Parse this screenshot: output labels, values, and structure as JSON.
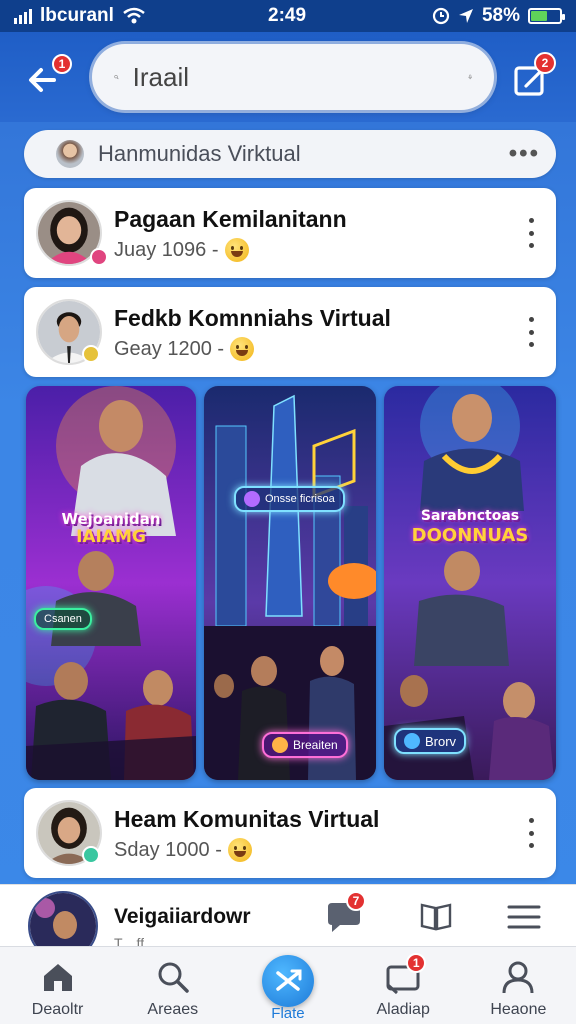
{
  "status_bar": {
    "carrier": "lbcuranl",
    "time": "2:49",
    "battery_percent": "58%",
    "battery_level": 0.58
  },
  "top_bar": {
    "back_badge": "1",
    "search_value": "Iraail",
    "compose_badge": "2"
  },
  "community_pill": {
    "label": "Hanmunidas Virktual"
  },
  "posts": [
    {
      "name": "Pagaan Kemilanitann",
      "meta": "Juay 1096 -"
    },
    {
      "name": "Fedkb Komnniahs Virtual",
      "meta": "Geay 1200 -"
    },
    {
      "name": "Heam Komunitas Virtual",
      "meta": "Sday 1000 -"
    }
  ],
  "media": [
    {
      "title_line1": "Wejoanidan",
      "title_line2": "IAIAMG",
      "chip": "",
      "badge": "Csanen"
    },
    {
      "title_line1": "",
      "title_line2": "",
      "chip": "Onsse ficrisoa",
      "badge": "Breaiten"
    },
    {
      "title_line1": "Sarabnctoas",
      "title_line2": "DOONNUAS",
      "chip": "",
      "badge": "Brorv"
    }
  ],
  "now_playing": {
    "title": "Veigaiiardowr",
    "subtitle": "T....ff",
    "chat_badge": "7"
  },
  "bottom_nav": [
    {
      "label": "Deaoltr",
      "icon": "home-icon"
    },
    {
      "label": "Areaes",
      "icon": "search-icon"
    },
    {
      "label": "Flate",
      "icon": "share-icon"
    },
    {
      "label": "Aladiap",
      "icon": "message-icon",
      "badge": "1"
    },
    {
      "label": "Heaone",
      "icon": "profile-icon"
    }
  ],
  "colors": {
    "accent": "#1d7ad8",
    "header": "#1f5ec6",
    "badge": "#e33131"
  }
}
